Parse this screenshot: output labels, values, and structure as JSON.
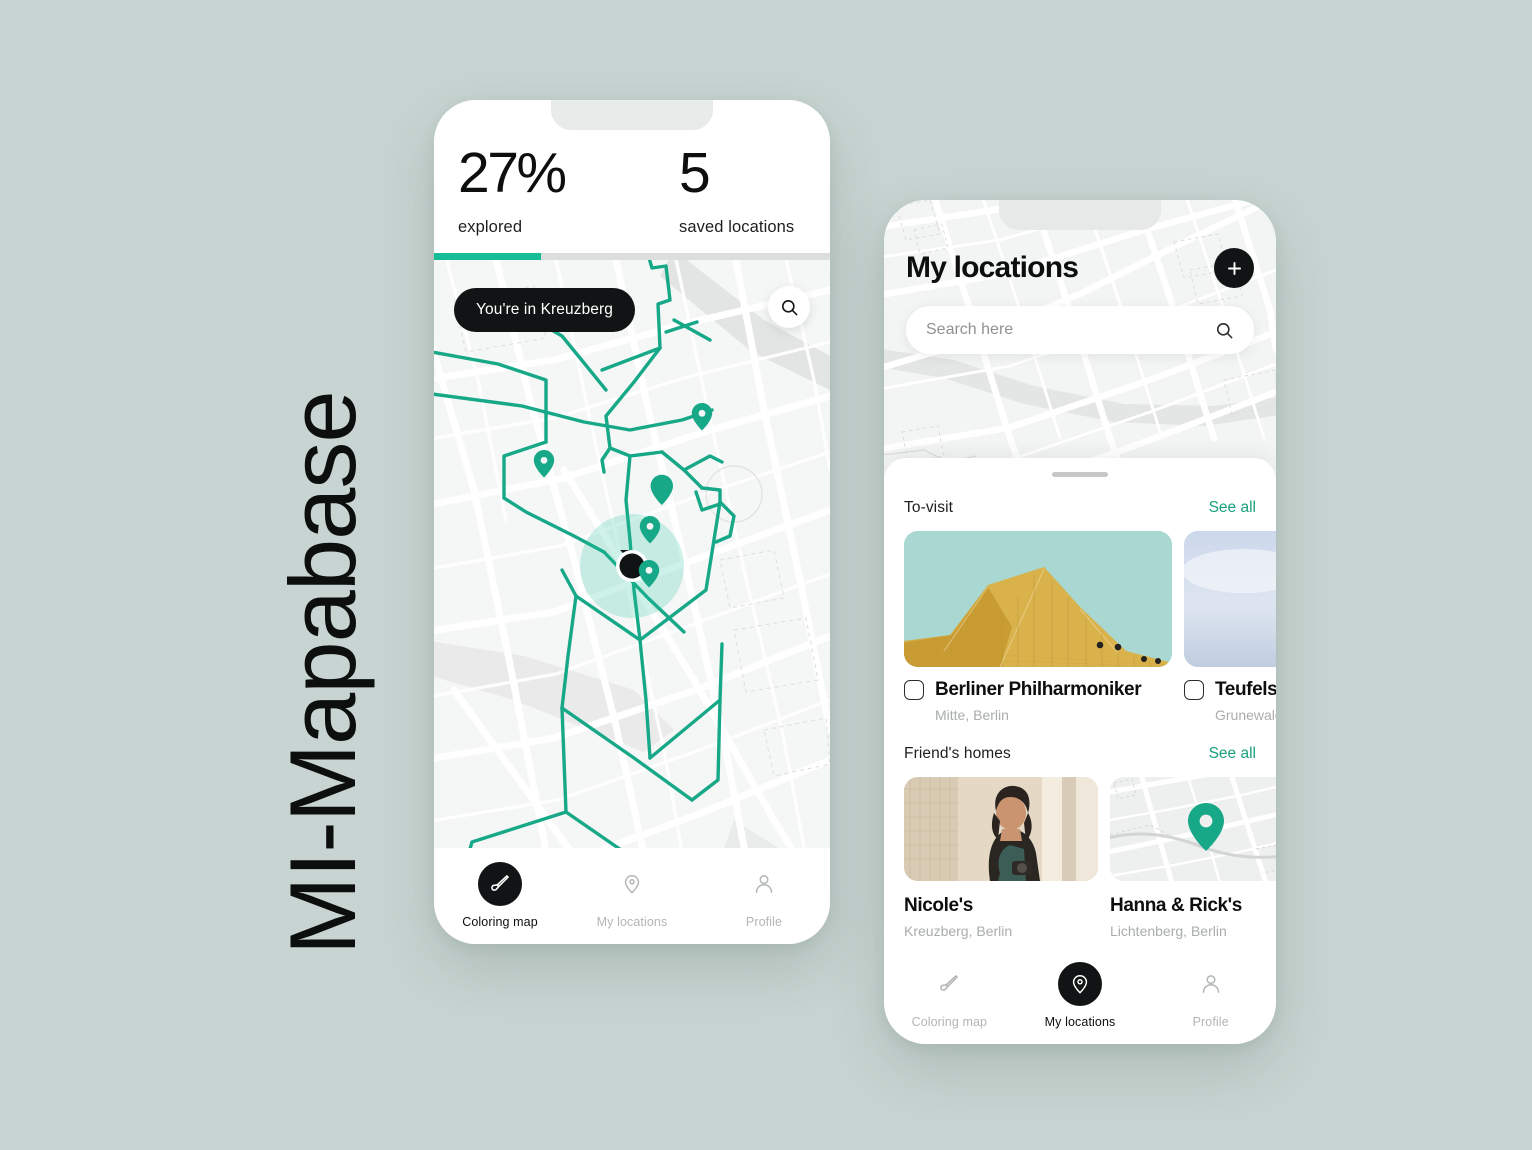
{
  "brand": {
    "title": "MI-Mapabase"
  },
  "theme": {
    "background": "#c8d4d1",
    "accent_green": "#17bd96",
    "link_green": "#1aa07c",
    "ink": "#0c0f0e",
    "muted": "#a9adac"
  },
  "phone_one": {
    "name": "coloring-map-screen",
    "stats": {
      "explored": {
        "value": "27%",
        "label": "explored"
      },
      "saved": {
        "value": "5",
        "label": "saved locations"
      },
      "progress_percent": 27
    },
    "map": {
      "place_pill": "You're in Kreuzberg",
      "search_icon": "search-icon",
      "current_location_icon": "current-location-dot",
      "pin_icon": "map-pin-icon",
      "pin_count": 5
    },
    "nav": {
      "items": [
        {
          "label": "Coloring map",
          "icon": "paintbrush-icon",
          "active": true
        },
        {
          "label": "My locations",
          "icon": "map-pin-icon",
          "active": false
        },
        {
          "label": "Profile",
          "icon": "user-icon",
          "active": false
        }
      ]
    }
  },
  "phone_two": {
    "name": "my-locations-screen",
    "header": {
      "title": "My locations",
      "add_icon": "plus-icon"
    },
    "search": {
      "placeholder": "Search here",
      "value": "",
      "icon": "search-icon"
    },
    "sections": [
      {
        "title": "To-visit",
        "see_all": "See all",
        "items": [
          {
            "name": "Berliner Philharmoniker",
            "sub": "Mitte, Berlin",
            "checked": false,
            "photo": "ph-philharmonie"
          },
          {
            "name": "Teufelsberg",
            "sub": "Grunewald, Berlin",
            "checked": false,
            "photo": "ph-teufelsberg"
          }
        ]
      },
      {
        "title": "Friend's homes",
        "see_all": "See all",
        "items": [
          {
            "name": "Nicole's",
            "sub": "Kreuzberg, Berlin",
            "photo": "ph-nicole"
          },
          {
            "name": "Hanna & Rick's",
            "sub": "Lichtenberg, Berlin",
            "photo": "ph-minimap"
          }
        ]
      }
    ],
    "nav": {
      "items": [
        {
          "label": "Coloring map",
          "icon": "paintbrush-icon",
          "active": false
        },
        {
          "label": "My locations",
          "icon": "map-pin-icon",
          "active": true
        },
        {
          "label": "Profile",
          "icon": "user-icon",
          "active": false
        }
      ]
    }
  }
}
